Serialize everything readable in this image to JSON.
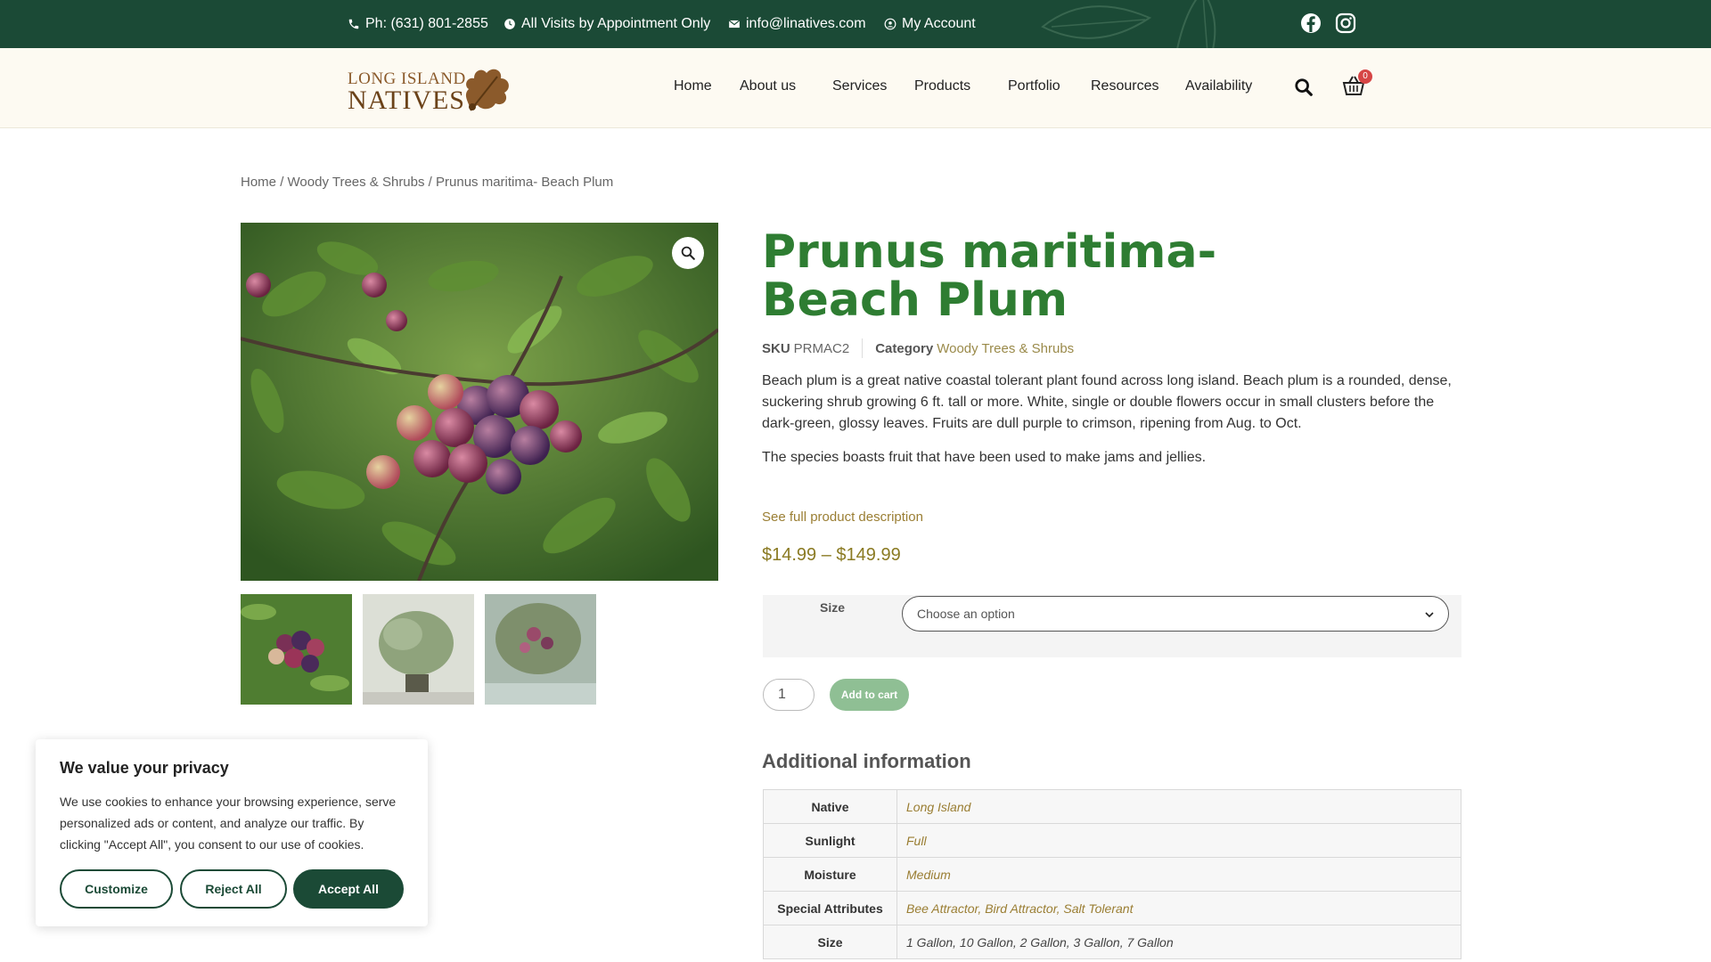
{
  "topbar": {
    "phone": "Ph: (631) 801-2855",
    "visits": "All Visits by Appointment Only",
    "email": "info@linatives.com",
    "account": "My Account",
    "social": [
      "facebook-icon",
      "instagram-icon"
    ]
  },
  "brand": {
    "line1": "LONG ISLAND",
    "line2": "NATIVES"
  },
  "nav": {
    "items": [
      "Home",
      "About us",
      "Services",
      "Products",
      "Portfolio",
      "Resources",
      "Availability"
    ],
    "cart_count": "0"
  },
  "breadcrumb": {
    "home": "Home",
    "category": "Woody Trees & Shrubs",
    "current": "Prunus maritima- Beach Plum"
  },
  "product": {
    "title": "Prunus maritima- Beach Plum",
    "sku_label": "SKU",
    "sku": "PRMAC2",
    "category_label": "Category",
    "category": "Woody Trees & Shrubs",
    "description_1": "Beach plum is a great native coastal tolerant plant found across long island.  Beach plum is a rounded, dense, suckering shrub growing 6 ft. tall or more. White, single or double flowers occur in small clusters before the dark-green, glossy leaves. Fruits are dull purple to crimson, ripening from Aug. to Oct.",
    "description_2": "The species boasts fruit that have been used to make jams and jellies.",
    "full_description_link": "See full product description",
    "price": "$14.99 – $149.99",
    "size_label": "Size",
    "size_placeholder": "Choose an option",
    "quantity": "1",
    "add_to_cart": "Add to cart"
  },
  "additional": {
    "title": "Additional information",
    "rows": [
      {
        "key": "Native",
        "value": "Long Island"
      },
      {
        "key": "Sunlight",
        "value": "Full"
      },
      {
        "key": "Moisture",
        "value": "Medium"
      },
      {
        "key": "Special Attributes",
        "value": "Bee Attractor, Bird Attractor, Salt Tolerant"
      },
      {
        "key": "Size",
        "value": "1 Gallon, 10 Gallon, 2 Gallon, 3 Gallon, 7 Gallon"
      }
    ]
  },
  "cookie": {
    "title": "We value your privacy",
    "message": "We use cookies to enhance your browsing experience, serve personalized ads or content, and analyze our traffic. By clicking \"Accept All\", you consent to our use of cookies.",
    "customize": "Customize",
    "reject": "Reject All",
    "accept": "Accept All"
  },
  "colors": {
    "topbar": "#1b4a36",
    "title": "#2e7d32",
    "accent": "#9a7e33",
    "add_to_cart": "#8fbf94"
  }
}
